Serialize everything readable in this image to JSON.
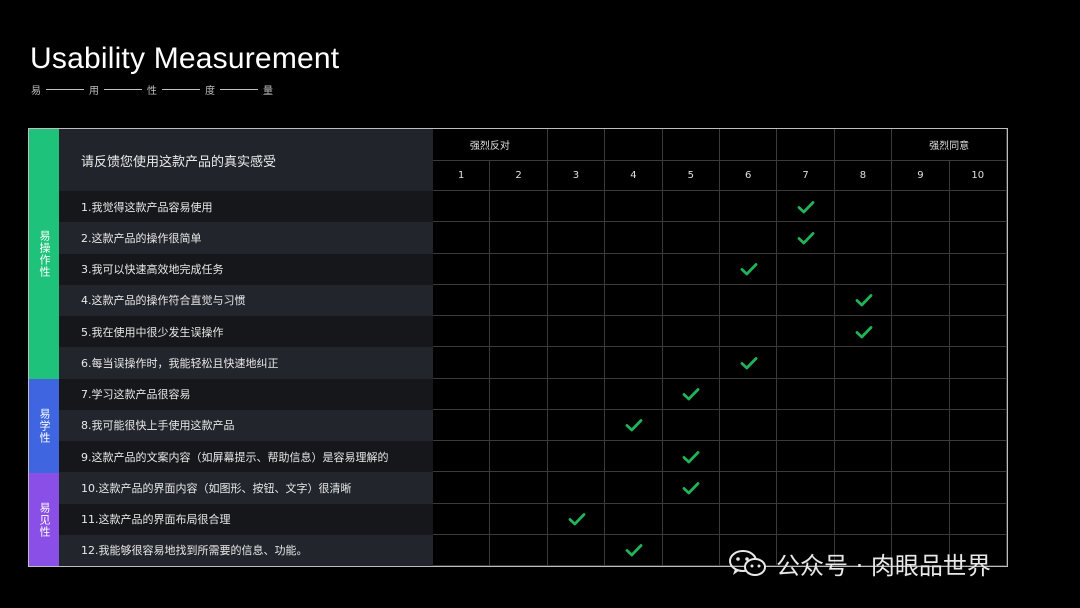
{
  "slide": {
    "title": "Usability Measurement",
    "subtitle_chars": [
      "易",
      "用",
      "性",
      "度",
      "量"
    ]
  },
  "table": {
    "question_header": "请反馈您使用这款产品的真实感受",
    "scale_left_label": "强烈反对",
    "scale_right_label": "强烈同意",
    "scale_numbers": [
      "1",
      "2",
      "3",
      "4",
      "5",
      "6",
      "7",
      "8",
      "9",
      "10"
    ],
    "categories": [
      {
        "label": "易操作性",
        "color": "#1fc27a"
      },
      {
        "label": "易学性",
        "color": "#3f66e0"
      },
      {
        "label": "易见性",
        "color": "#8a4fe6"
      }
    ],
    "questions": [
      {
        "text": "1.我觉得这款产品容易使用",
        "score": 7
      },
      {
        "text": "2.这款产品的操作很简单",
        "score": 7
      },
      {
        "text": "3.我可以快速高效地完成任务",
        "score": 6
      },
      {
        "text": "4.这款产品的操作符合直觉与习惯",
        "score": 8
      },
      {
        "text": "5.我在使用中很少发生误操作",
        "score": 8
      },
      {
        "text": "6.每当误操作时，我能轻松且快速地纠正",
        "score": 6
      },
      {
        "text": "7.学习这款产品很容易",
        "score": 5
      },
      {
        "text": "8.我可能很快上手使用这款产品",
        "score": 4
      },
      {
        "text": "9.这款产品的文案内容（如屏幕提示、帮助信息）是容易理解的",
        "score": 5
      },
      {
        "text": "10.这款产品的界面内容（如图形、按钮、文字）很清晰",
        "score": 5
      },
      {
        "text": "11.这款产品的界面布局很合理",
        "score": 3
      },
      {
        "text": "12.我能够很容易地找到所需要的信息、功能。",
        "score": 4
      }
    ],
    "check_color": "#21b35a"
  },
  "watermark": {
    "text": "公众号 · 肉眼品世界",
    "icon": "wechat-icon"
  }
}
